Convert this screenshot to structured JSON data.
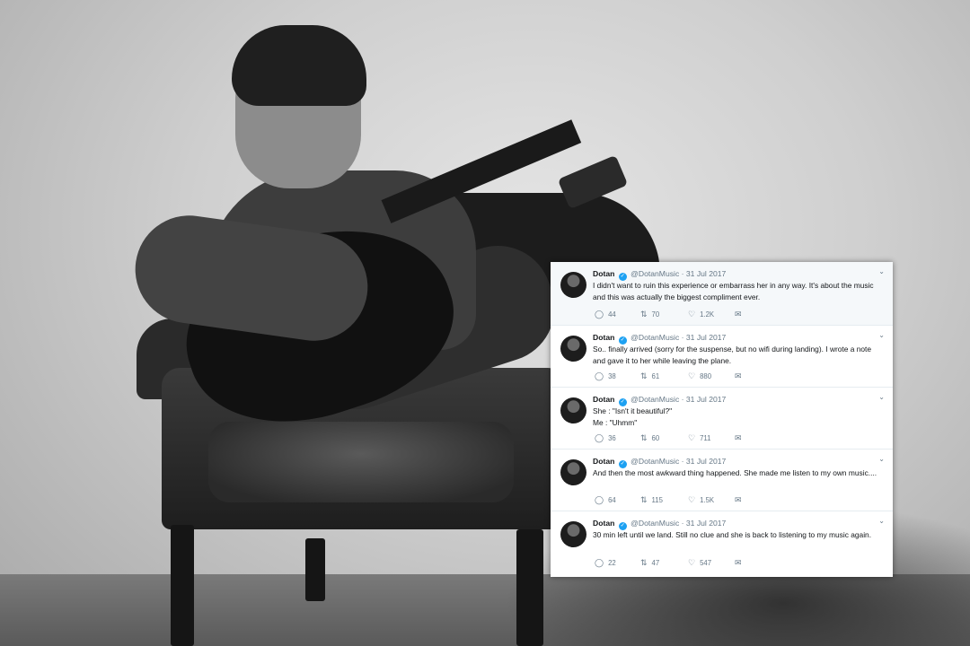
{
  "tweets": [
    {
      "name": "Dotan",
      "handle": "@DotanMusic",
      "date": "· 31 Jul 2017",
      "text": "I didn't want to ruin this experience or embarrass her in any way. It's about the music and this was actually the biggest compliment ever.",
      "replies": "44",
      "retweets": "70",
      "likes": "1.2K"
    },
    {
      "name": "Dotan",
      "handle": "@DotanMusic",
      "date": "· 31 Jul 2017",
      "text": "So.. finally arrived (sorry for the suspense, but no wifi during landing). I wrote a note and gave it to her while leaving the plane.",
      "replies": "38",
      "retweets": "61",
      "likes": "880"
    },
    {
      "name": "Dotan",
      "handle": "@DotanMusic",
      "date": "· 31 Jul 2017",
      "text": "She : \"Isn't it beautiful?\"\nMe : \"Uhmm\"",
      "replies": "36",
      "retweets": "60",
      "likes": "711"
    },
    {
      "name": "Dotan",
      "handle": "@DotanMusic",
      "date": "· 31 Jul 2017",
      "text": "And then the most awkward thing happened. She made me listen to my own music....",
      "replies": "64",
      "retweets": "115",
      "likes": "1.5K"
    },
    {
      "name": "Dotan",
      "handle": "@DotanMusic",
      "date": "· 31 Jul 2017",
      "text": "30 min left until we land. Still no clue and she is back to listening to my music again.",
      "replies": "22",
      "retweets": "47",
      "likes": "547"
    }
  ],
  "icons": {
    "verified": "verified-badge-icon",
    "reply": "reply-icon",
    "retweet": "retweet-icon",
    "like": "heart-icon",
    "dm": "envelope-icon",
    "more": "chevron-down-icon"
  },
  "colors": {
    "verified": "#1da1f2",
    "secondary_text": "#657786",
    "primary_text": "#14171a"
  }
}
